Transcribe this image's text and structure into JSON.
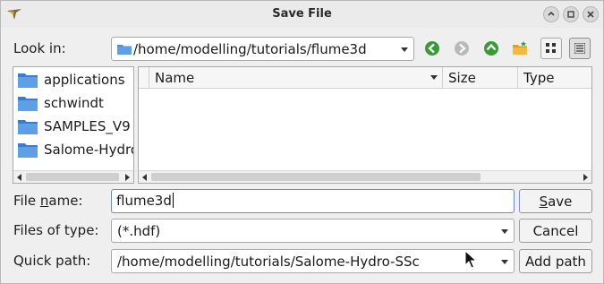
{
  "window": {
    "title": "Save File",
    "controls": [
      "pin-icon",
      "restore-icon",
      "close-icon"
    ]
  },
  "look_in": {
    "label": "Look in:",
    "path": "/home/modelling/tutorials/flume3d",
    "nav_icons": [
      "back-arrow-icon",
      "forward-arrow-icon",
      "parent-directory-icon",
      "new-folder-icon",
      "list-view-icon",
      "detail-view-icon"
    ]
  },
  "sidebar": {
    "items": [
      {
        "label": "applications"
      },
      {
        "label": "schwindt"
      },
      {
        "label": "SAMPLES_V9"
      },
      {
        "label": "Salome-Hydro"
      }
    ]
  },
  "filelist": {
    "columns": [
      "Name",
      "Size",
      "Type"
    ],
    "rows": []
  },
  "filename": {
    "label_pre": "File ",
    "label_u": "n",
    "label_post": "ame:",
    "value": "flume3d"
  },
  "filetype": {
    "label": "Files of type:",
    "value": "(*.hdf)"
  },
  "quickpath": {
    "label": "Quick path:",
    "value": "/home/modelling/tutorials/Salome-Hydro-SSc"
  },
  "buttons": {
    "save_u": "S",
    "save_rest": "ave",
    "cancel": "Cancel",
    "add_path": "Add path"
  },
  "colors": {
    "folder": "#4a8fd8",
    "nav_green": "#3a9a3a",
    "input_border": "#6b8cc0"
  }
}
